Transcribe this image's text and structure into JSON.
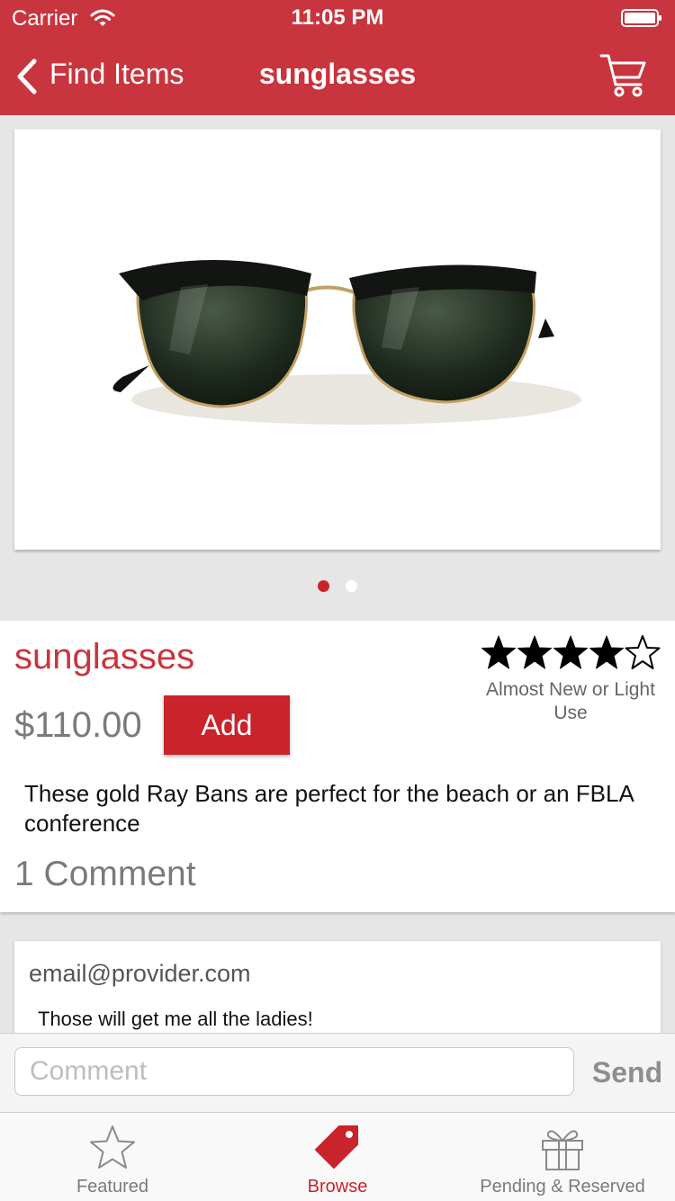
{
  "status_bar": {
    "carrier": "Carrier",
    "time": "11:05 PM"
  },
  "nav": {
    "back_label": "Find Items",
    "title": "sunglasses",
    "cart_icon": "shopping-cart-icon"
  },
  "gallery": {
    "page_count": 2,
    "current_page": 1
  },
  "product": {
    "title": "sunglasses",
    "price": "$110.00",
    "add_label": "Add",
    "rating": 4,
    "rating_max": 5,
    "condition": "Almost New or Light Use",
    "description": "These gold Ray Bans are perfect for the beach or an FBLA conference",
    "comment_count": "1 Comment"
  },
  "comments": [
    {
      "author": "email@provider.com",
      "text": "Those will get me all the ladies!"
    }
  ],
  "composer": {
    "placeholder": "Comment",
    "send_label": "Send"
  },
  "tabs": [
    {
      "label": "Featured",
      "icon": "star-outline-icon",
      "active": false
    },
    {
      "label": "Browse",
      "icon": "price-tag-icon",
      "active": true
    },
    {
      "label": "Pending & Reserved",
      "icon": "gift-icon",
      "active": false
    }
  ],
  "colors": {
    "brand_red": "#c9353e",
    "active_red": "#c9232c",
    "inactive_gray": "#7a7a7a"
  }
}
